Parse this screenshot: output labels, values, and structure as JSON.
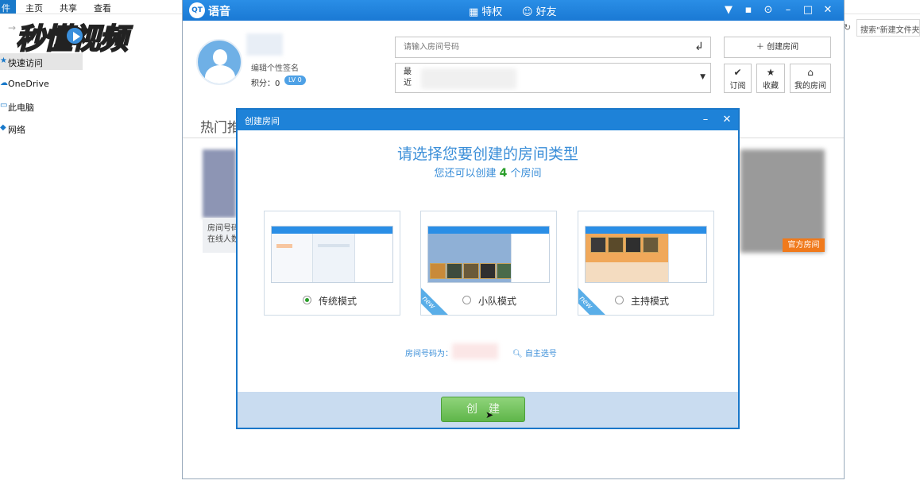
{
  "explorer": {
    "ribbon": {
      "file": "件",
      "home": "主页",
      "share": "共享",
      "view": "查看"
    },
    "search_placeholder": "搜索\"新建文件夹",
    "nav": [
      "快速访问",
      "OneDrive",
      "此电脑",
      "网络"
    ]
  },
  "watermark": "秒懂视频",
  "qt": {
    "app_name": "语音",
    "logo": "QT",
    "nav": {
      "privilege": "特权",
      "friends": "好友"
    },
    "user": {
      "signature": "编辑个性签名",
      "score_label": "积分：0",
      "level": "LV 0"
    },
    "room_input_placeholder": "请输入房间号码",
    "recent_label": "最近",
    "create_room": "创建房间",
    "side_buttons": {
      "subscribe": "订阅",
      "favorite": "收藏",
      "my_rooms": "我的房间"
    },
    "hot_label": "热门推",
    "card_left": {
      "line1": "房间号码",
      "line2": "在线人数"
    },
    "official_badge": "官方房间"
  },
  "dialog": {
    "title": "创建房间",
    "heading": "请选择您要创建的房间类型",
    "sub_prefix": "您还可以创建",
    "sub_count": "4",
    "sub_suffix": "个房间",
    "modes": [
      {
        "label": "传统模式",
        "selected": true,
        "new": false
      },
      {
        "label": "小队模式",
        "selected": false,
        "new": true
      },
      {
        "label": "主持模式",
        "selected": false,
        "new": true
      }
    ],
    "new_tag": "new",
    "room_no_label": "房间号码为：",
    "self_pick": "自主选号",
    "create_button": "创建"
  },
  "colors": {
    "accent": "#1e82d8",
    "create_button": "#6fc25a",
    "count": "#2a9e2a",
    "official": "#f07a1c"
  }
}
